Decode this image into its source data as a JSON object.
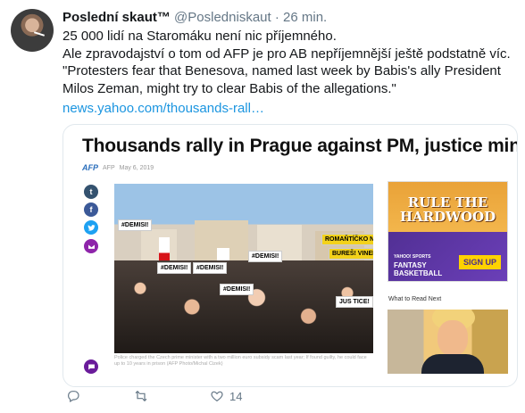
{
  "tweet": {
    "display_name": "Poslední skaut™",
    "handle": "@Posledniskaut",
    "separator": "·",
    "time": "26 min.",
    "lines": [
      "25 000 lidí na Staromáku není nic příjemného.",
      "Ale zpravodajství o tom od AFP je pro AB nepříjemnější ještě podstatně víc.",
      "\"Protesters fear that Benesova, named last week by Babis's ally President Milos Zeman, might try to clear Babis of the allegations.\""
    ],
    "link": "news.yahoo.com/thousands-rall…"
  },
  "card": {
    "title": "Thousands rally in Prague against PM, justice minister",
    "source_logo": "AFP",
    "byline_source": "AFP",
    "byline_date": "May 6, 2019",
    "signs": [
      "#DEMISI!",
      "#DEMISI!",
      "#DEMISI!",
      "#DEMISI!",
      "#DEMISI!",
      "JUS TICE!",
      "ROMAŇTÍČKO NENÍ ZLEPŠÍ",
      "BUREŠ! VINEN!"
    ],
    "caption": "Police charged the Czech prime minister with a two million euro subsidy scam last year; If found guilty, he could face up to 10 years in prison (AFP Photo/Michal Cizek)",
    "ad": {
      "headline_1": "RULE THE",
      "headline_2": "HARDWOOD",
      "brand_1": "YAHOO! SPORTS",
      "brand_2": "FANTASY",
      "brand_3": "BASKETBALL",
      "cta": "SIGN UP"
    },
    "related_label": "What to Read Next"
  },
  "actions": {
    "reply_count": "",
    "retweet_count": "",
    "like_count": "14"
  },
  "colors": {
    "link": "#1b95e0",
    "muted": "#657786",
    "border": "#e1e8ed"
  }
}
